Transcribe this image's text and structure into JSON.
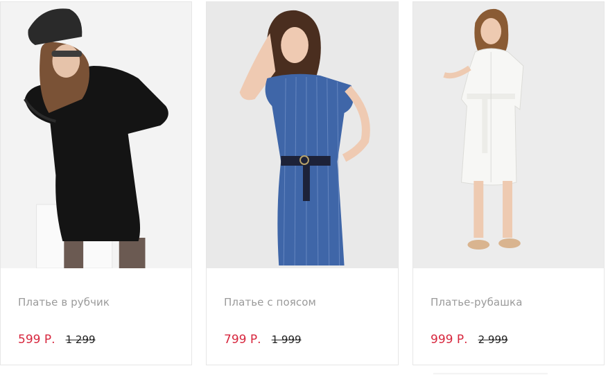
{
  "products": [
    {
      "title": "Платье в рубчик",
      "price": "599 Р.",
      "old_price": "1 299",
      "image": "black-dress-photo"
    },
    {
      "title": "Платье с поясом",
      "price": "799 Р.",
      "old_price": "1 999",
      "image": "blue-belted-dress-photo"
    },
    {
      "title": "Платье-рубашка",
      "price": "999 Р.",
      "old_price": "2 999",
      "image": "white-shirt-dress-photo"
    }
  ],
  "colors": {
    "price": "#d7263d",
    "title": "#9a9a9a",
    "old_price": "#222222",
    "border": "#e6e6e6"
  }
}
